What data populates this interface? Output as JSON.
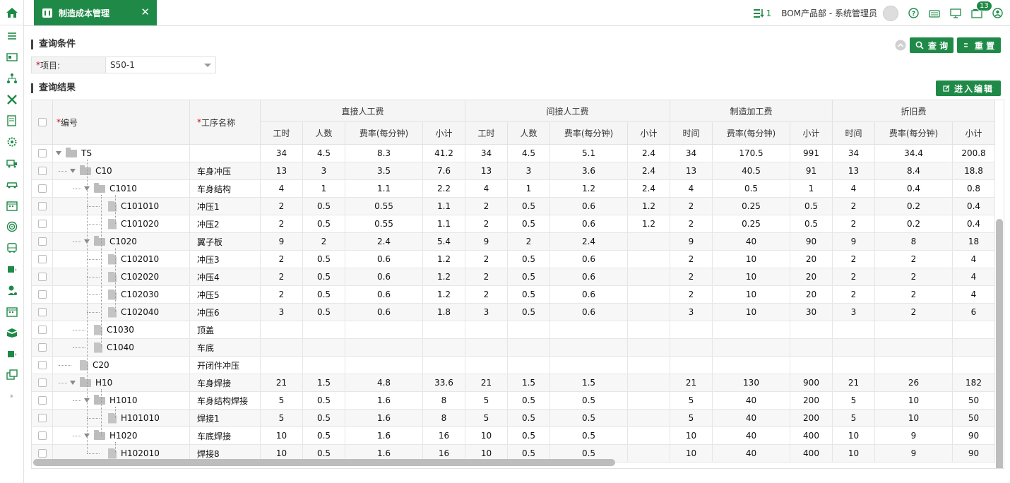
{
  "tab": {
    "title": "制造成本管理",
    "close": "✕"
  },
  "header": {
    "task_count": "1",
    "user": "BOM产品部 - 系统管理员",
    "msg_count": "13"
  },
  "query": {
    "title": "查询条件",
    "search_label": "查 询",
    "reset_label": "重 置",
    "project_label": "项目:",
    "project_value": "S50-1"
  },
  "result": {
    "title": "查询结果",
    "edit_label": "进入编辑"
  },
  "columns": {
    "code": "编号",
    "process": "工序名称",
    "groups": [
      "直接人工费",
      "间接人工费",
      "制造加工费",
      "折旧费"
    ],
    "sub": [
      "工时",
      "人数",
      "费率(每分钟)",
      "小计",
      "工时",
      "人数",
      "费率(每分钟)",
      "小计",
      "时间",
      "费率(每分钟)",
      "小计",
      "时间",
      "费率(每分钟)",
      "小计"
    ]
  },
  "rows": [
    {
      "code": "TS",
      "level": 0,
      "type": "folder",
      "expanded": true,
      "name": "",
      "v": [
        "34",
        "4.5",
        "8.3",
        "41.2",
        "34",
        "4.5",
        "5.1",
        "2.4",
        "34",
        "170.5",
        "991",
        "34",
        "34.4",
        "200.8"
      ]
    },
    {
      "code": "C10",
      "level": 1,
      "type": "folder",
      "expanded": true,
      "name": "车身冲压",
      "v": [
        "13",
        "3",
        "3.5",
        "7.6",
        "13",
        "3",
        "3.6",
        "2.4",
        "13",
        "40.5",
        "91",
        "13",
        "8.4",
        "18.8"
      ]
    },
    {
      "code": "C1010",
      "level": 2,
      "type": "folder",
      "expanded": true,
      "name": "车身结构",
      "v": [
        "4",
        "1",
        "1.1",
        "2.2",
        "4",
        "1",
        "1.2",
        "2.4",
        "4",
        "0.5",
        "1",
        "4",
        "0.4",
        "0.8"
      ]
    },
    {
      "code": "C101010",
      "level": 3,
      "type": "file",
      "name": "冲压1",
      "v": [
        "2",
        "0.5",
        "0.55",
        "1.1",
        "2",
        "0.5",
        "0.6",
        "1.2",
        "2",
        "0.25",
        "0.5",
        "2",
        "0.2",
        "0.4"
      ]
    },
    {
      "code": "C101020",
      "level": 3,
      "type": "file",
      "name": "冲压2",
      "v": [
        "2",
        "0.5",
        "0.55",
        "1.1",
        "2",
        "0.5",
        "0.6",
        "1.2",
        "2",
        "0.25",
        "0.5",
        "2",
        "0.2",
        "0.4"
      ]
    },
    {
      "code": "C1020",
      "level": 2,
      "type": "folder",
      "expanded": true,
      "name": "翼子板",
      "v": [
        "9",
        "2",
        "2.4",
        "5.4",
        "9",
        "2",
        "2.4",
        "",
        "9",
        "40",
        "90",
        "9",
        "8",
        "18"
      ]
    },
    {
      "code": "C102010",
      "level": 3,
      "type": "file",
      "name": "冲压3",
      "v": [
        "2",
        "0.5",
        "0.6",
        "1.2",
        "2",
        "0.5",
        "0.6",
        "",
        "2",
        "10",
        "20",
        "2",
        "2",
        "4"
      ]
    },
    {
      "code": "C102020",
      "level": 3,
      "type": "file",
      "name": "冲压4",
      "v": [
        "2",
        "0.5",
        "0.6",
        "1.2",
        "2",
        "0.5",
        "0.6",
        "",
        "2",
        "10",
        "20",
        "2",
        "2",
        "4"
      ]
    },
    {
      "code": "C102030",
      "level": 3,
      "type": "file",
      "name": "冲压5",
      "v": [
        "2",
        "0.5",
        "0.6",
        "1.2",
        "2",
        "0.5",
        "0.6",
        "",
        "2",
        "10",
        "20",
        "2",
        "2",
        "4"
      ]
    },
    {
      "code": "C102040",
      "level": 3,
      "type": "file",
      "name": "冲压6",
      "v": [
        "3",
        "0.5",
        "0.6",
        "1.8",
        "3",
        "0.5",
        "0.6",
        "",
        "3",
        "10",
        "30",
        "3",
        "2",
        "6"
      ]
    },
    {
      "code": "C1030",
      "level": 2,
      "type": "file",
      "name": "顶盖",
      "v": [
        "",
        "",
        "",
        "",
        "",
        "",
        "",
        "",
        "",
        "",
        "",
        "",
        "",
        ""
      ]
    },
    {
      "code": "C1040",
      "level": 2,
      "type": "file",
      "name": "车底",
      "v": [
        "",
        "",
        "",
        "",
        "",
        "",
        "",
        "",
        "",
        "",
        "",
        "",
        "",
        ""
      ]
    },
    {
      "code": "C20",
      "level": 1,
      "type": "file",
      "name": "开闭件冲压",
      "v": [
        "",
        "",
        "",
        "",
        "",
        "",
        "",
        "",
        "",
        "",
        "",
        "",
        "",
        ""
      ]
    },
    {
      "code": "H10",
      "level": 1,
      "type": "folder",
      "expanded": true,
      "name": "车身焊接",
      "v": [
        "21",
        "1.5",
        "4.8",
        "33.6",
        "21",
        "1.5",
        "1.5",
        "",
        "21",
        "130",
        "900",
        "21",
        "26",
        "182"
      ]
    },
    {
      "code": "H1010",
      "level": 2,
      "type": "folder",
      "expanded": true,
      "name": "车身结构焊接",
      "v": [
        "5",
        "0.5",
        "1.6",
        "8",
        "5",
        "0.5",
        "0.5",
        "",
        "5",
        "40",
        "200",
        "5",
        "10",
        "50"
      ]
    },
    {
      "code": "H101010",
      "level": 3,
      "type": "file",
      "name": "焊接1",
      "v": [
        "5",
        "0.5",
        "1.6",
        "8",
        "5",
        "0.5",
        "0.5",
        "",
        "5",
        "40",
        "200",
        "5",
        "10",
        "50"
      ]
    },
    {
      "code": "H1020",
      "level": 2,
      "type": "folder",
      "expanded": true,
      "name": "车底焊接",
      "v": [
        "10",
        "0.5",
        "1.6",
        "16",
        "10",
        "0.5",
        "0.5",
        "",
        "10",
        "40",
        "400",
        "10",
        "9",
        "90"
      ]
    },
    {
      "code": "H102010",
      "level": 3,
      "type": "file",
      "name": "焊接8",
      "v": [
        "10",
        "0.5",
        "1.6",
        "16",
        "10",
        "0.5",
        "0.5",
        "",
        "10",
        "40",
        "400",
        "10",
        "9",
        "90"
      ]
    }
  ],
  "sidebar_icons": [
    "home-icon",
    "menu-icon",
    "id-card-icon",
    "org-tree-icon",
    "tools-icon",
    "document-icon",
    "gear-icon",
    "truck-icon",
    "car-icon",
    "calendar-icon",
    "target-icon",
    "bus-icon",
    "tag-icon",
    "person-icon",
    "calendar-icon",
    "box-icon",
    "tag-icon",
    "window-icon",
    "expand-icon"
  ],
  "colors": {
    "accent": "#1f8a48"
  }
}
